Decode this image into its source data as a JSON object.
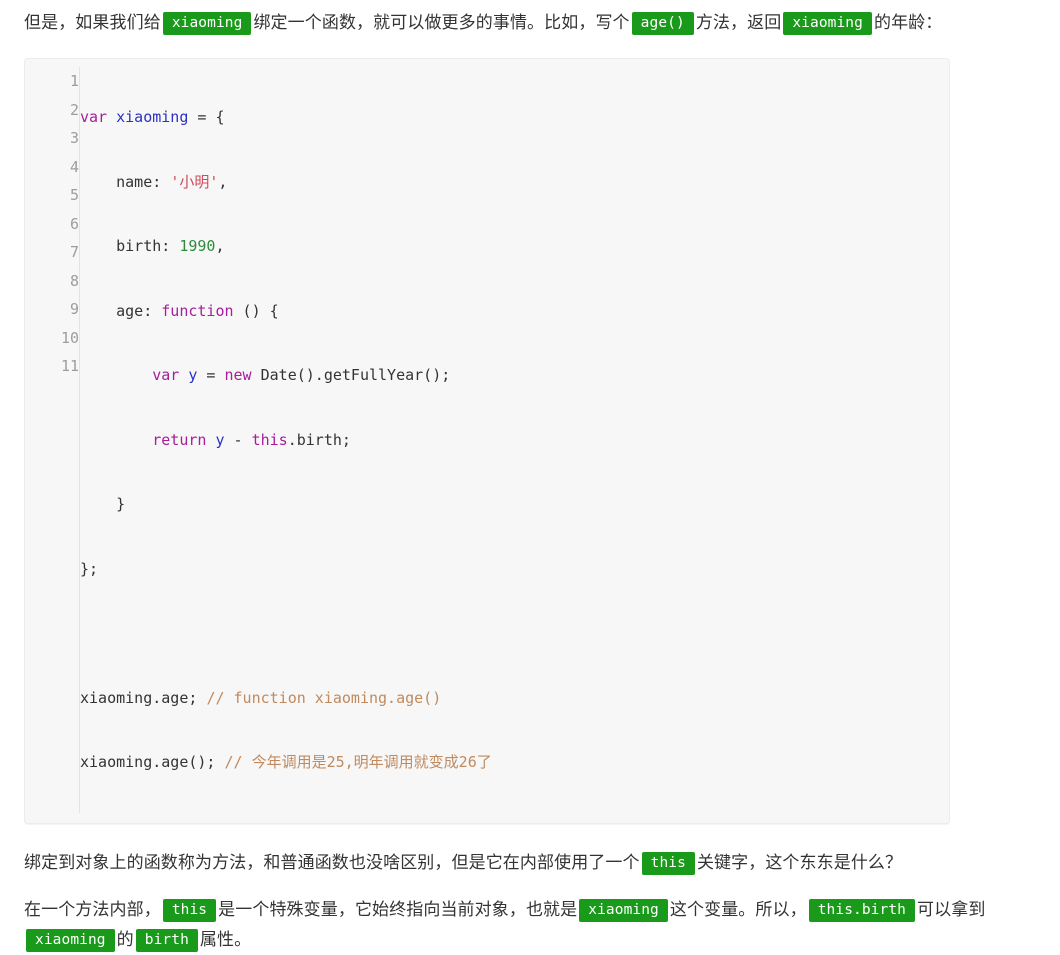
{
  "document": {
    "paragraph_1": {
      "segments": [
        {
          "type": "text",
          "value": "但是，如果我们给"
        },
        {
          "type": "code",
          "value": "xiaoming"
        },
        {
          "type": "text",
          "value": "绑定一个函数，就可以做更多的事情。比如，写个"
        },
        {
          "type": "code",
          "value": "age()"
        },
        {
          "type": "text",
          "value": "方法，返回"
        },
        {
          "type": "code",
          "value": "xiaoming"
        },
        {
          "type": "text",
          "value": "的年龄："
        }
      ],
      "t1": "但是，如果我们给",
      "c1": "xiaoming",
      "t2": "绑定一个函数，就可以做更多的事情。比如，写个",
      "c2": "age()",
      "t3": "方法，返",
      "t3b": "回",
      "c3": "xiaoming",
      "t4": "的年龄："
    },
    "paragraph_2": {
      "t1": "绑定到对象上的函数称为方法，和普通函数也没啥区别，但是它在内部使用了一个",
      "c1": "this",
      "t2": "关键字，这个东东是什么？"
    },
    "paragraph_3": {
      "t1": "在一个方法内部，",
      "c1": "this",
      "t2": "是一个特殊变量，它始终指向当前对象，也就是",
      "c2": "xiaoming",
      "t3": "这个变量。所以，",
      "c3": "this.birth",
      "t4": "可以拿到",
      "c4": "xiaoming",
      "t5": "的",
      "c5": "birth",
      "t6": "属性。"
    }
  },
  "code_block": {
    "language": "javascript",
    "line_numbers": [
      "1",
      "2",
      "3",
      "4",
      "5",
      "6",
      "7",
      "8",
      "9",
      "10",
      "11"
    ],
    "lines": [
      {
        "n": "1",
        "text": "var xiaoming = {"
      },
      {
        "n": "2",
        "text": "    name: '小明',"
      },
      {
        "n": "3",
        "text": "    birth: 1990,"
      },
      {
        "n": "4",
        "text": "    age: function () {"
      },
      {
        "n": "5",
        "text": "        var y = new Date().getFullYear();"
      },
      {
        "n": "6",
        "text": "        return y - this.birth;"
      },
      {
        "n": "7",
        "text": "    }"
      },
      {
        "n": "8",
        "text": "};"
      },
      {
        "n": "9",
        "text": ""
      },
      {
        "n": "10",
        "text": "xiaoming.age; // function xiaoming.age()"
      },
      {
        "n": "11",
        "text": "xiaoming.age(); // 今年调用是25,明年调用就变成26了"
      }
    ],
    "tokens": {
      "l1_kw": "var",
      "l1_var": "xiaoming",
      "l1_rest": " = {",
      "l2_key": "    name: ",
      "l2_str": "'小明'",
      "l2_end": ",",
      "l3_key": "    birth: ",
      "l3_num": "1990",
      "l3_end": ",",
      "l4_key": "    age: ",
      "l4_kw": "function",
      "l4_rest": " () {",
      "l5_ind": "        ",
      "l5_kw1": "var",
      "l5_var": " y",
      "l5_eq": " = ",
      "l5_kw2": "new",
      "l5_rest": " Date().getFullYear();",
      "l6_ind": "        ",
      "l6_kw1": "return",
      "l6_var": " y",
      "l6_op": " - ",
      "l6_kw2": "this",
      "l6_rest": ".birth;",
      "l7": "    }",
      "l8": "};",
      "l9": "",
      "l10_code": "xiaoming.age; ",
      "l10_cmt": "// function xiaoming.age()",
      "l11_code": "xiaoming.age(); ",
      "l11_cmt": "// 今年调用是25,明年调用就变成26了"
    }
  },
  "colors": {
    "page_background": "#ffffff",
    "text": "#333333",
    "inline_code_badge": "#1a9a1a",
    "inline_code_text": "#ffffff",
    "code_block_background": "#f7f7f7",
    "code_block_border": "#ececec",
    "gutter_text": "#9d9d9d",
    "gutter_divider": "#e3e3e3",
    "keyword": "#a71d9b",
    "variable": "#2b31c4",
    "string": "#d14b5a",
    "number": "#2e8b3d",
    "comment": "#c08a5e"
  }
}
